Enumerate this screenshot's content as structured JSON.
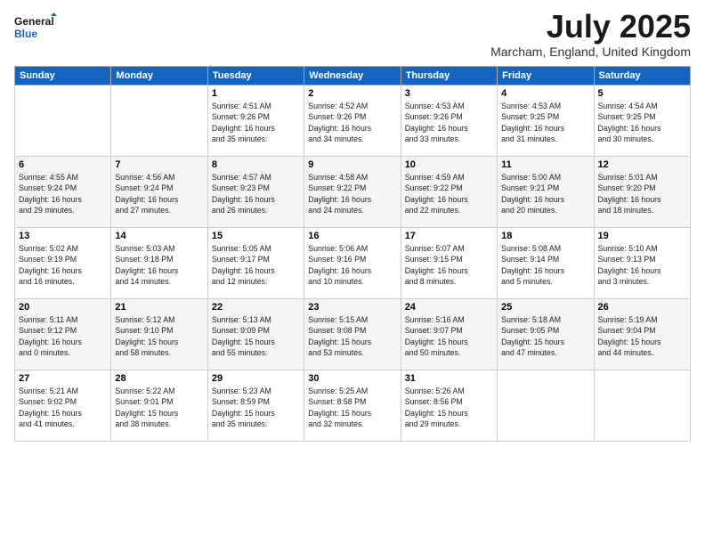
{
  "header": {
    "logo_line1": "General",
    "logo_line2": "Blue",
    "month": "July 2025",
    "location": "Marcham, England, United Kingdom"
  },
  "weekdays": [
    "Sunday",
    "Monday",
    "Tuesday",
    "Wednesday",
    "Thursday",
    "Friday",
    "Saturday"
  ],
  "weeks": [
    [
      {
        "day": "",
        "info": ""
      },
      {
        "day": "",
        "info": ""
      },
      {
        "day": "1",
        "info": "Sunrise: 4:51 AM\nSunset: 9:26 PM\nDaylight: 16 hours\nand 35 minutes."
      },
      {
        "day": "2",
        "info": "Sunrise: 4:52 AM\nSunset: 9:26 PM\nDaylight: 16 hours\nand 34 minutes."
      },
      {
        "day": "3",
        "info": "Sunrise: 4:53 AM\nSunset: 9:26 PM\nDaylight: 16 hours\nand 33 minutes."
      },
      {
        "day": "4",
        "info": "Sunrise: 4:53 AM\nSunset: 9:25 PM\nDaylight: 16 hours\nand 31 minutes."
      },
      {
        "day": "5",
        "info": "Sunrise: 4:54 AM\nSunset: 9:25 PM\nDaylight: 16 hours\nand 30 minutes."
      }
    ],
    [
      {
        "day": "6",
        "info": "Sunrise: 4:55 AM\nSunset: 9:24 PM\nDaylight: 16 hours\nand 29 minutes."
      },
      {
        "day": "7",
        "info": "Sunrise: 4:56 AM\nSunset: 9:24 PM\nDaylight: 16 hours\nand 27 minutes."
      },
      {
        "day": "8",
        "info": "Sunrise: 4:57 AM\nSunset: 9:23 PM\nDaylight: 16 hours\nand 26 minutes."
      },
      {
        "day": "9",
        "info": "Sunrise: 4:58 AM\nSunset: 9:22 PM\nDaylight: 16 hours\nand 24 minutes."
      },
      {
        "day": "10",
        "info": "Sunrise: 4:59 AM\nSunset: 9:22 PM\nDaylight: 16 hours\nand 22 minutes."
      },
      {
        "day": "11",
        "info": "Sunrise: 5:00 AM\nSunset: 9:21 PM\nDaylight: 16 hours\nand 20 minutes."
      },
      {
        "day": "12",
        "info": "Sunrise: 5:01 AM\nSunset: 9:20 PM\nDaylight: 16 hours\nand 18 minutes."
      }
    ],
    [
      {
        "day": "13",
        "info": "Sunrise: 5:02 AM\nSunset: 9:19 PM\nDaylight: 16 hours\nand 16 minutes."
      },
      {
        "day": "14",
        "info": "Sunrise: 5:03 AM\nSunset: 9:18 PM\nDaylight: 16 hours\nand 14 minutes."
      },
      {
        "day": "15",
        "info": "Sunrise: 5:05 AM\nSunset: 9:17 PM\nDaylight: 16 hours\nand 12 minutes."
      },
      {
        "day": "16",
        "info": "Sunrise: 5:06 AM\nSunset: 9:16 PM\nDaylight: 16 hours\nand 10 minutes."
      },
      {
        "day": "17",
        "info": "Sunrise: 5:07 AM\nSunset: 9:15 PM\nDaylight: 16 hours\nand 8 minutes."
      },
      {
        "day": "18",
        "info": "Sunrise: 5:08 AM\nSunset: 9:14 PM\nDaylight: 16 hours\nand 5 minutes."
      },
      {
        "day": "19",
        "info": "Sunrise: 5:10 AM\nSunset: 9:13 PM\nDaylight: 16 hours\nand 3 minutes."
      }
    ],
    [
      {
        "day": "20",
        "info": "Sunrise: 5:11 AM\nSunset: 9:12 PM\nDaylight: 16 hours\nand 0 minutes."
      },
      {
        "day": "21",
        "info": "Sunrise: 5:12 AM\nSunset: 9:10 PM\nDaylight: 15 hours\nand 58 minutes."
      },
      {
        "day": "22",
        "info": "Sunrise: 5:13 AM\nSunset: 9:09 PM\nDaylight: 15 hours\nand 55 minutes."
      },
      {
        "day": "23",
        "info": "Sunrise: 5:15 AM\nSunset: 9:08 PM\nDaylight: 15 hours\nand 53 minutes."
      },
      {
        "day": "24",
        "info": "Sunrise: 5:16 AM\nSunset: 9:07 PM\nDaylight: 15 hours\nand 50 minutes."
      },
      {
        "day": "25",
        "info": "Sunrise: 5:18 AM\nSunset: 9:05 PM\nDaylight: 15 hours\nand 47 minutes."
      },
      {
        "day": "26",
        "info": "Sunrise: 5:19 AM\nSunset: 9:04 PM\nDaylight: 15 hours\nand 44 minutes."
      }
    ],
    [
      {
        "day": "27",
        "info": "Sunrise: 5:21 AM\nSunset: 9:02 PM\nDaylight: 15 hours\nand 41 minutes."
      },
      {
        "day": "28",
        "info": "Sunrise: 5:22 AM\nSunset: 9:01 PM\nDaylight: 15 hours\nand 38 minutes."
      },
      {
        "day": "29",
        "info": "Sunrise: 5:23 AM\nSunset: 8:59 PM\nDaylight: 15 hours\nand 35 minutes."
      },
      {
        "day": "30",
        "info": "Sunrise: 5:25 AM\nSunset: 8:58 PM\nDaylight: 15 hours\nand 32 minutes."
      },
      {
        "day": "31",
        "info": "Sunrise: 5:26 AM\nSunset: 8:56 PM\nDaylight: 15 hours\nand 29 minutes."
      },
      {
        "day": "",
        "info": ""
      },
      {
        "day": "",
        "info": ""
      }
    ]
  ]
}
